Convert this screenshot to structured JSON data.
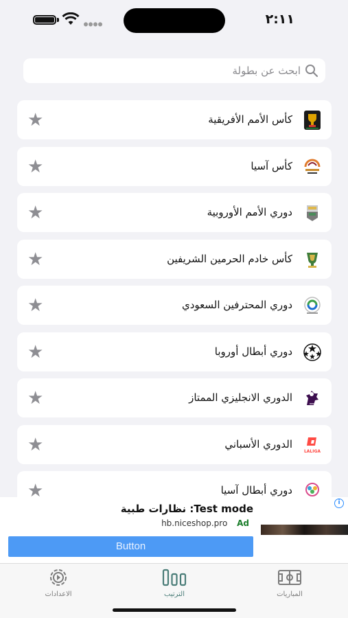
{
  "status_bar": {
    "time": "٢:١١"
  },
  "search": {
    "placeholder": "ابحث عن بطولة"
  },
  "competitions": [
    {
      "label": "كأس الأمم الأفريقية",
      "logo": "afcon-logo"
    },
    {
      "label": "كأس آسيا",
      "logo": "asian-cup-logo"
    },
    {
      "label": "دوري الأمم الأوروبية",
      "logo": "nations-league-logo"
    },
    {
      "label": "كأس خادم الحرمين الشريفين",
      "logo": "kings-cup-logo"
    },
    {
      "label": "دوري المحترفين السعودي",
      "logo": "saudi-pro-league-logo"
    },
    {
      "label": "دوري أبطال أوروبا",
      "logo": "champions-league-logo"
    },
    {
      "label": "الدوري الانجليزي الممتاز",
      "logo": "premier-league-logo"
    },
    {
      "label": "الدوري الأسباني",
      "logo": "laliga-logo"
    },
    {
      "label": "دوري أبطال آسيا",
      "logo": "afc-champions-league-logo"
    }
  ],
  "logo_text": {
    "laliga": "LALIGA"
  },
  "ad": {
    "title": "Test mode: نظارات طبية",
    "badge": "Ad",
    "url": "hb.niceshop.pro",
    "button_label": "Button",
    "info": "i"
  },
  "tabs": [
    {
      "label": "الاعدادات",
      "icon": "settings-gear-icon"
    },
    {
      "label": "الترتيب",
      "icon": "standings-bars-icon",
      "active": true
    },
    {
      "label": "المباريات",
      "icon": "pitch-icon"
    }
  ],
  "colors": {
    "accent": "#4a7d78",
    "ad_button": "#4d9af5",
    "star": "#8e8e93",
    "background": "#f2f2f6"
  }
}
